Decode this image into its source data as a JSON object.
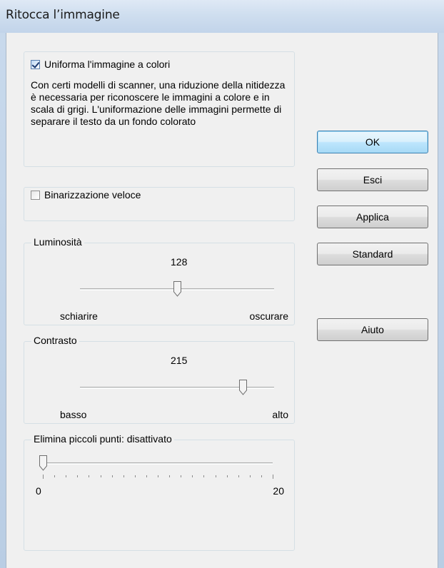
{
  "window": {
    "title": "Ritocca l’immagine"
  },
  "smooth_group": {
    "checkbox_label": "Uniforma l'immagine a colori",
    "checked": true,
    "description": "Con certi modelli di scanner, una riduzione della nitidezza è necessaria per riconoscere le immagini a colore e in scala di grigi. L'uniformazione delle immagini permette di separare il testo da un fondo colorato"
  },
  "binarization": {
    "checkbox_label": "Binarizzazione veloce",
    "checked": false
  },
  "brightness": {
    "title": "Luminosità",
    "value": "128",
    "min_label": "schiarire",
    "max_label": "oscurare",
    "fraction": 0.5
  },
  "contrast": {
    "title": "Contrasto",
    "value": "215",
    "min_label": "basso",
    "max_label": "alto",
    "fraction": 0.84
  },
  "specks": {
    "title": "Elimina piccoli punti: disattivato",
    "min_label": "0",
    "max_label": "20",
    "fraction": 0.0
  },
  "buttons": {
    "ok": "OK",
    "exit": "Esci",
    "apply": "Applica",
    "standard": "Standard",
    "help": "Aiuto"
  }
}
